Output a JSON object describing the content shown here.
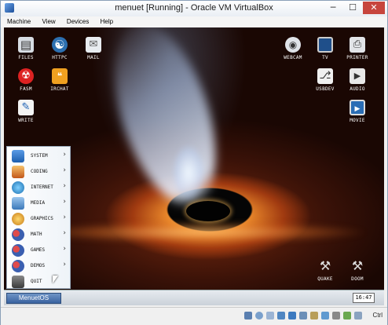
{
  "window": {
    "title": "menuet [Running] - Oracle VM VirtualBox",
    "minimize_glyph": "─",
    "maximize_glyph": "☐",
    "close_glyph": "✕"
  },
  "menubar": {
    "items": [
      "Machine",
      "View",
      "Devices",
      "Help"
    ]
  },
  "desktop_icons": {
    "files": {
      "label": "FILES",
      "icon": "files-icon"
    },
    "httpc": {
      "label": "HTTPC",
      "icon": "globe-icon"
    },
    "mail": {
      "label": "MAIL",
      "icon": "mail-icon"
    },
    "fasm": {
      "label": "FASM",
      "icon": "radiation-icon"
    },
    "irchat": {
      "label": "IRCHAT",
      "icon": "chat-icon"
    },
    "write": {
      "label": "WRITE",
      "icon": "write-icon"
    },
    "webcam": {
      "label": "WEBCAM",
      "icon": "webcam-icon"
    },
    "tv": {
      "label": "TV",
      "icon": "tv-icon"
    },
    "printer": {
      "label": "PRINTER",
      "icon": "printer-icon"
    },
    "usbdev": {
      "label": "USBDEV",
      "icon": "usb-icon"
    },
    "audio": {
      "label": "AUDIO",
      "icon": "audio-icon"
    },
    "movie": {
      "label": "MOVIE",
      "icon": "movie-icon"
    },
    "quake": {
      "label": "QUAKE",
      "icon": "tools-icon"
    },
    "doom": {
      "label": "DOOM",
      "icon": "tools-icon"
    }
  },
  "start_menu": {
    "items": [
      {
        "label": "SYSTEM",
        "arrow": "›"
      },
      {
        "label": "CODING",
        "arrow": "›"
      },
      {
        "label": "INTERNET",
        "arrow": "›"
      },
      {
        "label": "MEDIA",
        "arrow": "›"
      },
      {
        "label": "GRAPHICS",
        "arrow": "›"
      },
      {
        "label": "MATH",
        "arrow": "›"
      },
      {
        "label": "GAMES",
        "arrow": "›"
      },
      {
        "label": "DEMOS",
        "arrow": "›"
      },
      {
        "label": "QUIT",
        "arrow": ""
      }
    ]
  },
  "taskbar": {
    "start_label": "MenuetOS",
    "clock": "16:47"
  },
  "statusbar": {
    "host_key": "Ctrl"
  }
}
